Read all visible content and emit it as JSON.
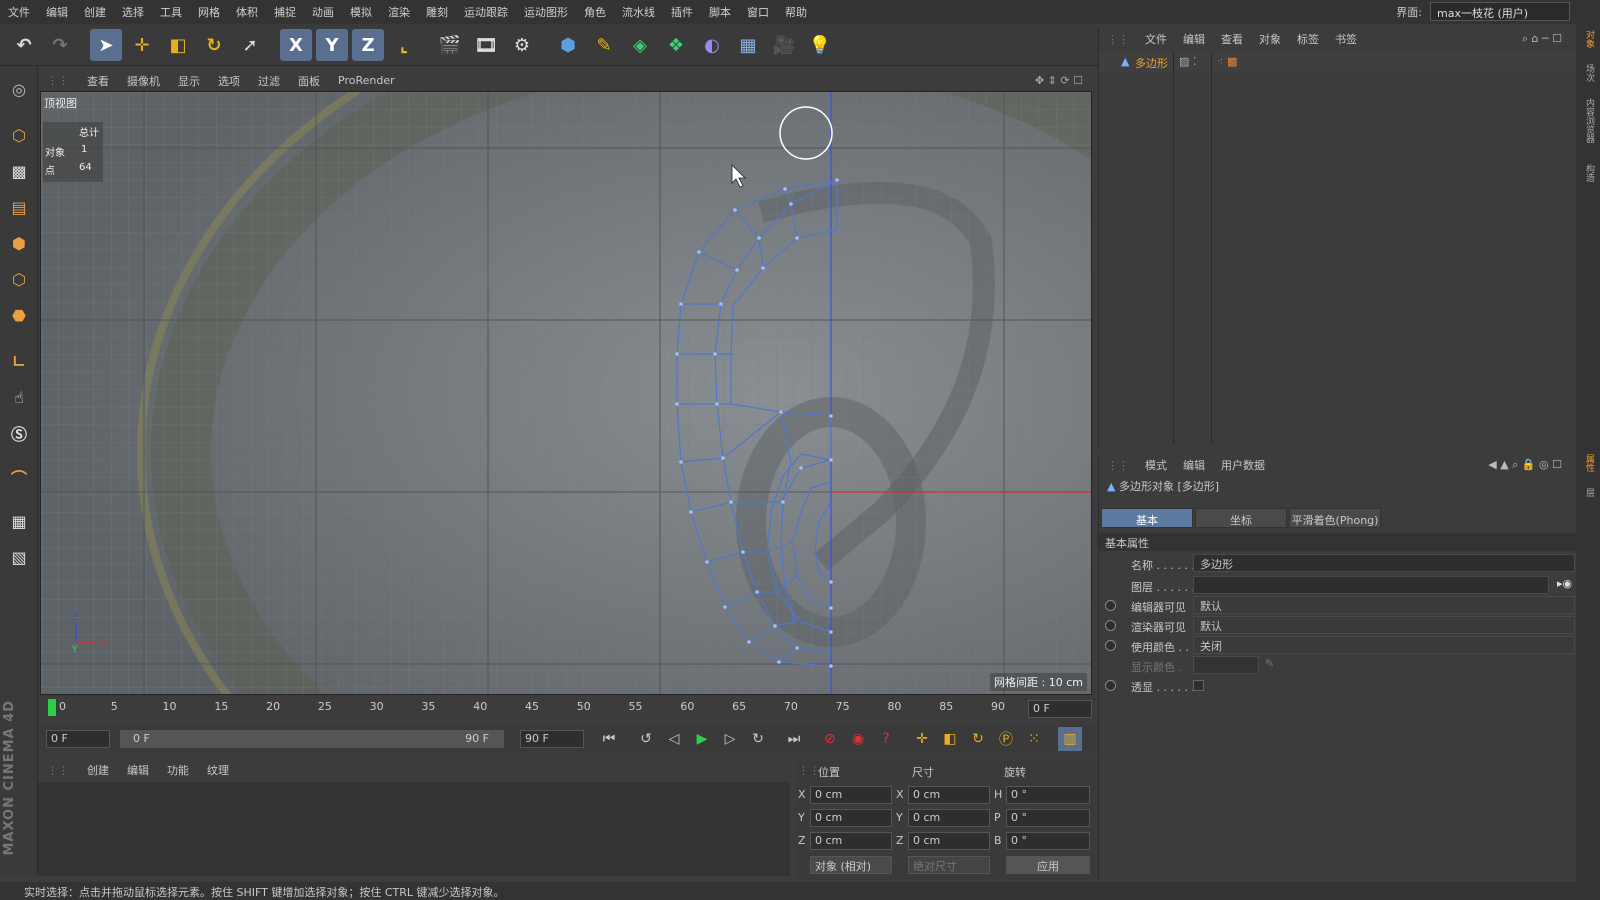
{
  "menubar": {
    "items": [
      "文件",
      "编辑",
      "创建",
      "选择",
      "工具",
      "网格",
      "体积",
      "捕捉",
      "动画",
      "模拟",
      "渲染",
      "雕刻",
      "运动跟踪",
      "运动图形",
      "角色",
      "流水线",
      "插件",
      "脚本",
      "窗口",
      "帮助"
    ],
    "layout_label": "界面:",
    "layout_value": "max一枝花 (用户)"
  },
  "toolbar": {
    "axis_x": "X",
    "axis_y": "Y",
    "axis_z": "Z"
  },
  "viewport": {
    "menu": [
      "查看",
      "摄像机",
      "显示",
      "选项",
      "过滤",
      "面板",
      "ProRender"
    ],
    "view_name": "顶视图",
    "stats": {
      "header": "总计",
      "objects_label": "对象",
      "objects_value": "1",
      "points_label": "点",
      "points_value": "64"
    },
    "grid_spacing": "网格间距 : 10 cm",
    "axis_x": "X",
    "axis_y": "Y",
    "axis_z": "Z"
  },
  "timeline": {
    "ticks": [
      "0",
      "5",
      "10",
      "15",
      "20",
      "25",
      "30",
      "35",
      "40",
      "45",
      "50",
      "55",
      "60",
      "65",
      "70",
      "75",
      "80",
      "85",
      "90"
    ],
    "current_frame_display": "0 F",
    "start_field": "0 F",
    "range_start": "0 F",
    "range_end": "90 F",
    "end_field": "90 F",
    "current_frame": 0,
    "total_frames": 90
  },
  "material_manager": {
    "menu": [
      "创建",
      "编辑",
      "功能",
      "纹理"
    ],
    "brand": "MAXON CINEMA 4D"
  },
  "coordinates": {
    "headers": [
      "位置",
      "尺寸",
      "旋转"
    ],
    "rows": [
      {
        "axis": "X",
        "pos": "0 cm",
        "size_axis": "X",
        "size": "0 cm",
        "rot_axis": "H",
        "rot": "0 °"
      },
      {
        "axis": "Y",
        "pos": "0 cm",
        "size_axis": "Y",
        "size": "0 cm",
        "rot_axis": "P",
        "rot": "0 °"
      },
      {
        "axis": "Z",
        "pos": "0 cm",
        "size_axis": "Z",
        "size": "0 cm",
        "rot_axis": "B",
        "rot": "0 °"
      }
    ],
    "mode": "对象 (相对)",
    "size_mode": "绝对尺寸",
    "apply": "应用"
  },
  "object_manager": {
    "menu": [
      "文件",
      "编辑",
      "查看",
      "对象",
      "标签",
      "书签"
    ],
    "object_name": "多边形"
  },
  "attributes": {
    "menu": [
      "模式",
      "编辑",
      "用户数据"
    ],
    "title": "多边形对象 [多边形]",
    "tabs": [
      "基本",
      "坐标",
      "平滑着色(Phong)"
    ],
    "section": "基本属性",
    "props": [
      {
        "label": "名称 . . . . . .",
        "value": "多边形"
      },
      {
        "label": "图层 . . . . . .",
        "value": ""
      },
      {
        "label": "编辑器可见",
        "value": "默认"
      },
      {
        "label": "渲染器可见",
        "value": "默认"
      },
      {
        "label": "使用颜色 . .",
        "value": "关闭"
      },
      {
        "label": "显示颜色 .",
        "value": ""
      },
      {
        "label": "透显 . . . . . .",
        "value": ""
      }
    ]
  },
  "side_strip": [
    "对象",
    "场次",
    "内容浏览器",
    "构造"
  ],
  "side_strip_bottom": [
    "属性",
    "层"
  ],
  "status": "实时选择：点击并拖动鼠标选择元素。按住 SHIFT 键增加选择对象；按住 CTRL 键减少选择对象。",
  "colors": {
    "accent": "#5c7ba0",
    "mesh": "#4f78c8",
    "y_axis": "#3a4fe0",
    "x_axis": "#d03030"
  }
}
